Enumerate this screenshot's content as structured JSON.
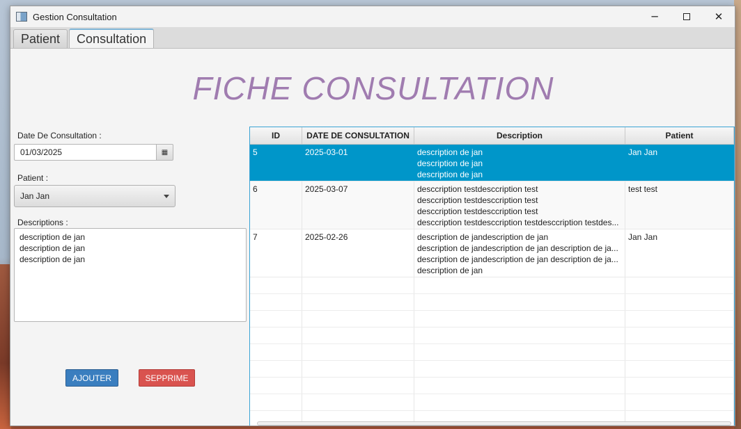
{
  "window": {
    "title": "Gestion Consultation",
    "controls": {
      "minimize": "─",
      "close": "✕"
    }
  },
  "tabs": [
    {
      "label": "Patient"
    },
    {
      "label": "Consultation"
    }
  ],
  "page_title": "FICHE CONSULTATION",
  "form": {
    "date_label": "Date De Consultation :",
    "date_value": "01/03/2025",
    "calendar_icon": "calendar-icon",
    "patient_label": "Patient :",
    "patient_value": "Jan Jan",
    "descriptions_label": "Descriptions :",
    "descriptions_value": "description de jan\ndescription de jan\ndescription de jan",
    "add_button": "AJOUTER",
    "delete_button": "SEPPRIME"
  },
  "table": {
    "headers": [
      "ID",
      "DATE DE CONSULTATION",
      "Description",
      "Patient"
    ],
    "rows": [
      {
        "id": "5",
        "date": "2025-03-01",
        "description": "description de jan\ndescription de jan\ndescription de jan",
        "patient": "Jan Jan"
      },
      {
        "id": "6",
        "date": "2025-03-07",
        "description": "desccription testdesccription test\ndesccription testdesccription test\ndesccription testdesccription test\ndesccription testdesccription testdesccription testdes...",
        "patient": "test test"
      },
      {
        "id": "7",
        "date": "2025-02-26",
        "description": "description de jandescription de jan\ndescription de jandescription de jan description de ja...\ndescription de jandescription de jan description de ja...\ndescription de jan",
        "patient": "Jan Jan"
      }
    ]
  },
  "colors": {
    "accent": "#0096c9",
    "title": "#a07cb0",
    "add_button": "#3a7ebf",
    "delete_button": "#d9534f"
  }
}
